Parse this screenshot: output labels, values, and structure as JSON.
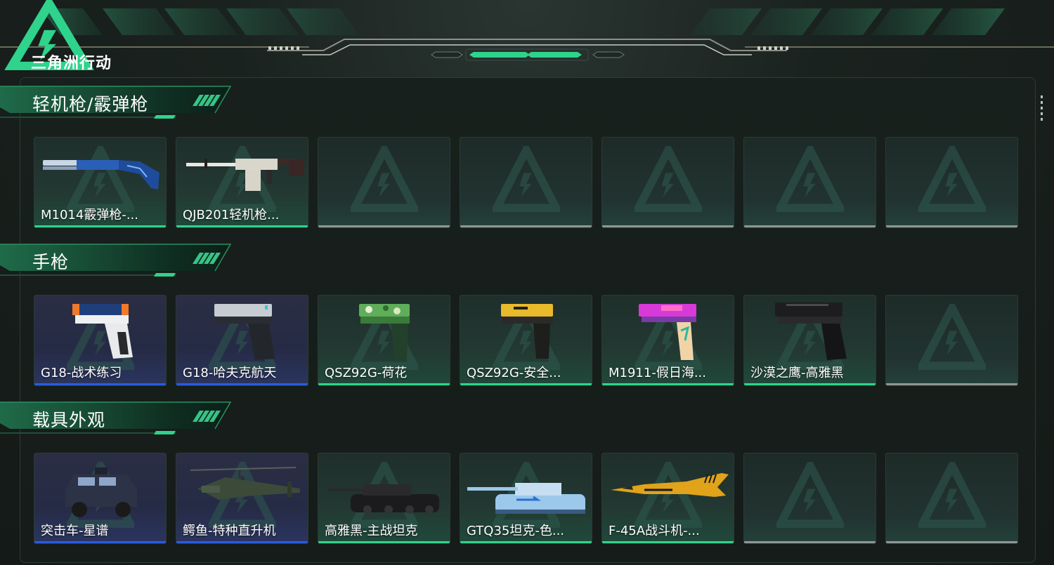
{
  "app": {
    "logo_text": "三角洲行动",
    "colors": {
      "accent": "#2fd38b",
      "rare_blue": "#2a5be0",
      "empty_gray": "#8f9693"
    }
  },
  "sections": [
    {
      "title": "轻机枪/霰弹枪",
      "items": [
        {
          "name": "M1014霰弹枪-...",
          "rarity": "green",
          "icon": "shotgun-blue-skin"
        },
        {
          "name": "QJB201轻机枪...",
          "rarity": "green",
          "icon": "lmg-white-skin"
        },
        {
          "name": "",
          "rarity": "empty"
        },
        {
          "name": "",
          "rarity": "empty"
        },
        {
          "name": "",
          "rarity": "empty"
        },
        {
          "name": "",
          "rarity": "empty"
        },
        {
          "name": "",
          "rarity": "empty"
        }
      ]
    },
    {
      "title": "手枪",
      "items": [
        {
          "name": "G18-战术练习",
          "rarity": "blue",
          "icon": "pistol-white-orange"
        },
        {
          "name": "G18-哈夫克航天",
          "rarity": "blue",
          "icon": "pistol-gray"
        },
        {
          "name": "QSZ92G-荷花",
          "rarity": "green",
          "icon": "pistol-green-camo"
        },
        {
          "name": "QSZ92G-安全...",
          "rarity": "green",
          "icon": "pistol-yellow"
        },
        {
          "name": "M1911-假日海...",
          "rarity": "green",
          "icon": "pistol-pink"
        },
        {
          "name": "沙漠之鹰-高雅黑",
          "rarity": "green",
          "icon": "pistol-black"
        },
        {
          "name": "",
          "rarity": "empty"
        }
      ]
    },
    {
      "title": "载具外观",
      "items": [
        {
          "name": "突击车-星谱",
          "rarity": "blue",
          "icon": "armored-car"
        },
        {
          "name": "鳄鱼-特种直升机",
          "rarity": "blue",
          "icon": "helicopter"
        },
        {
          "name": "高雅黑-主战坦克",
          "rarity": "green",
          "icon": "tank-black"
        },
        {
          "name": "GTQ35坦克-色...",
          "rarity": "green",
          "icon": "tank-blue"
        },
        {
          "name": "F-45A战斗机-...",
          "rarity": "green",
          "icon": "fighter-jet"
        },
        {
          "name": "",
          "rarity": "empty"
        },
        {
          "name": "",
          "rarity": "empty"
        }
      ]
    }
  ]
}
